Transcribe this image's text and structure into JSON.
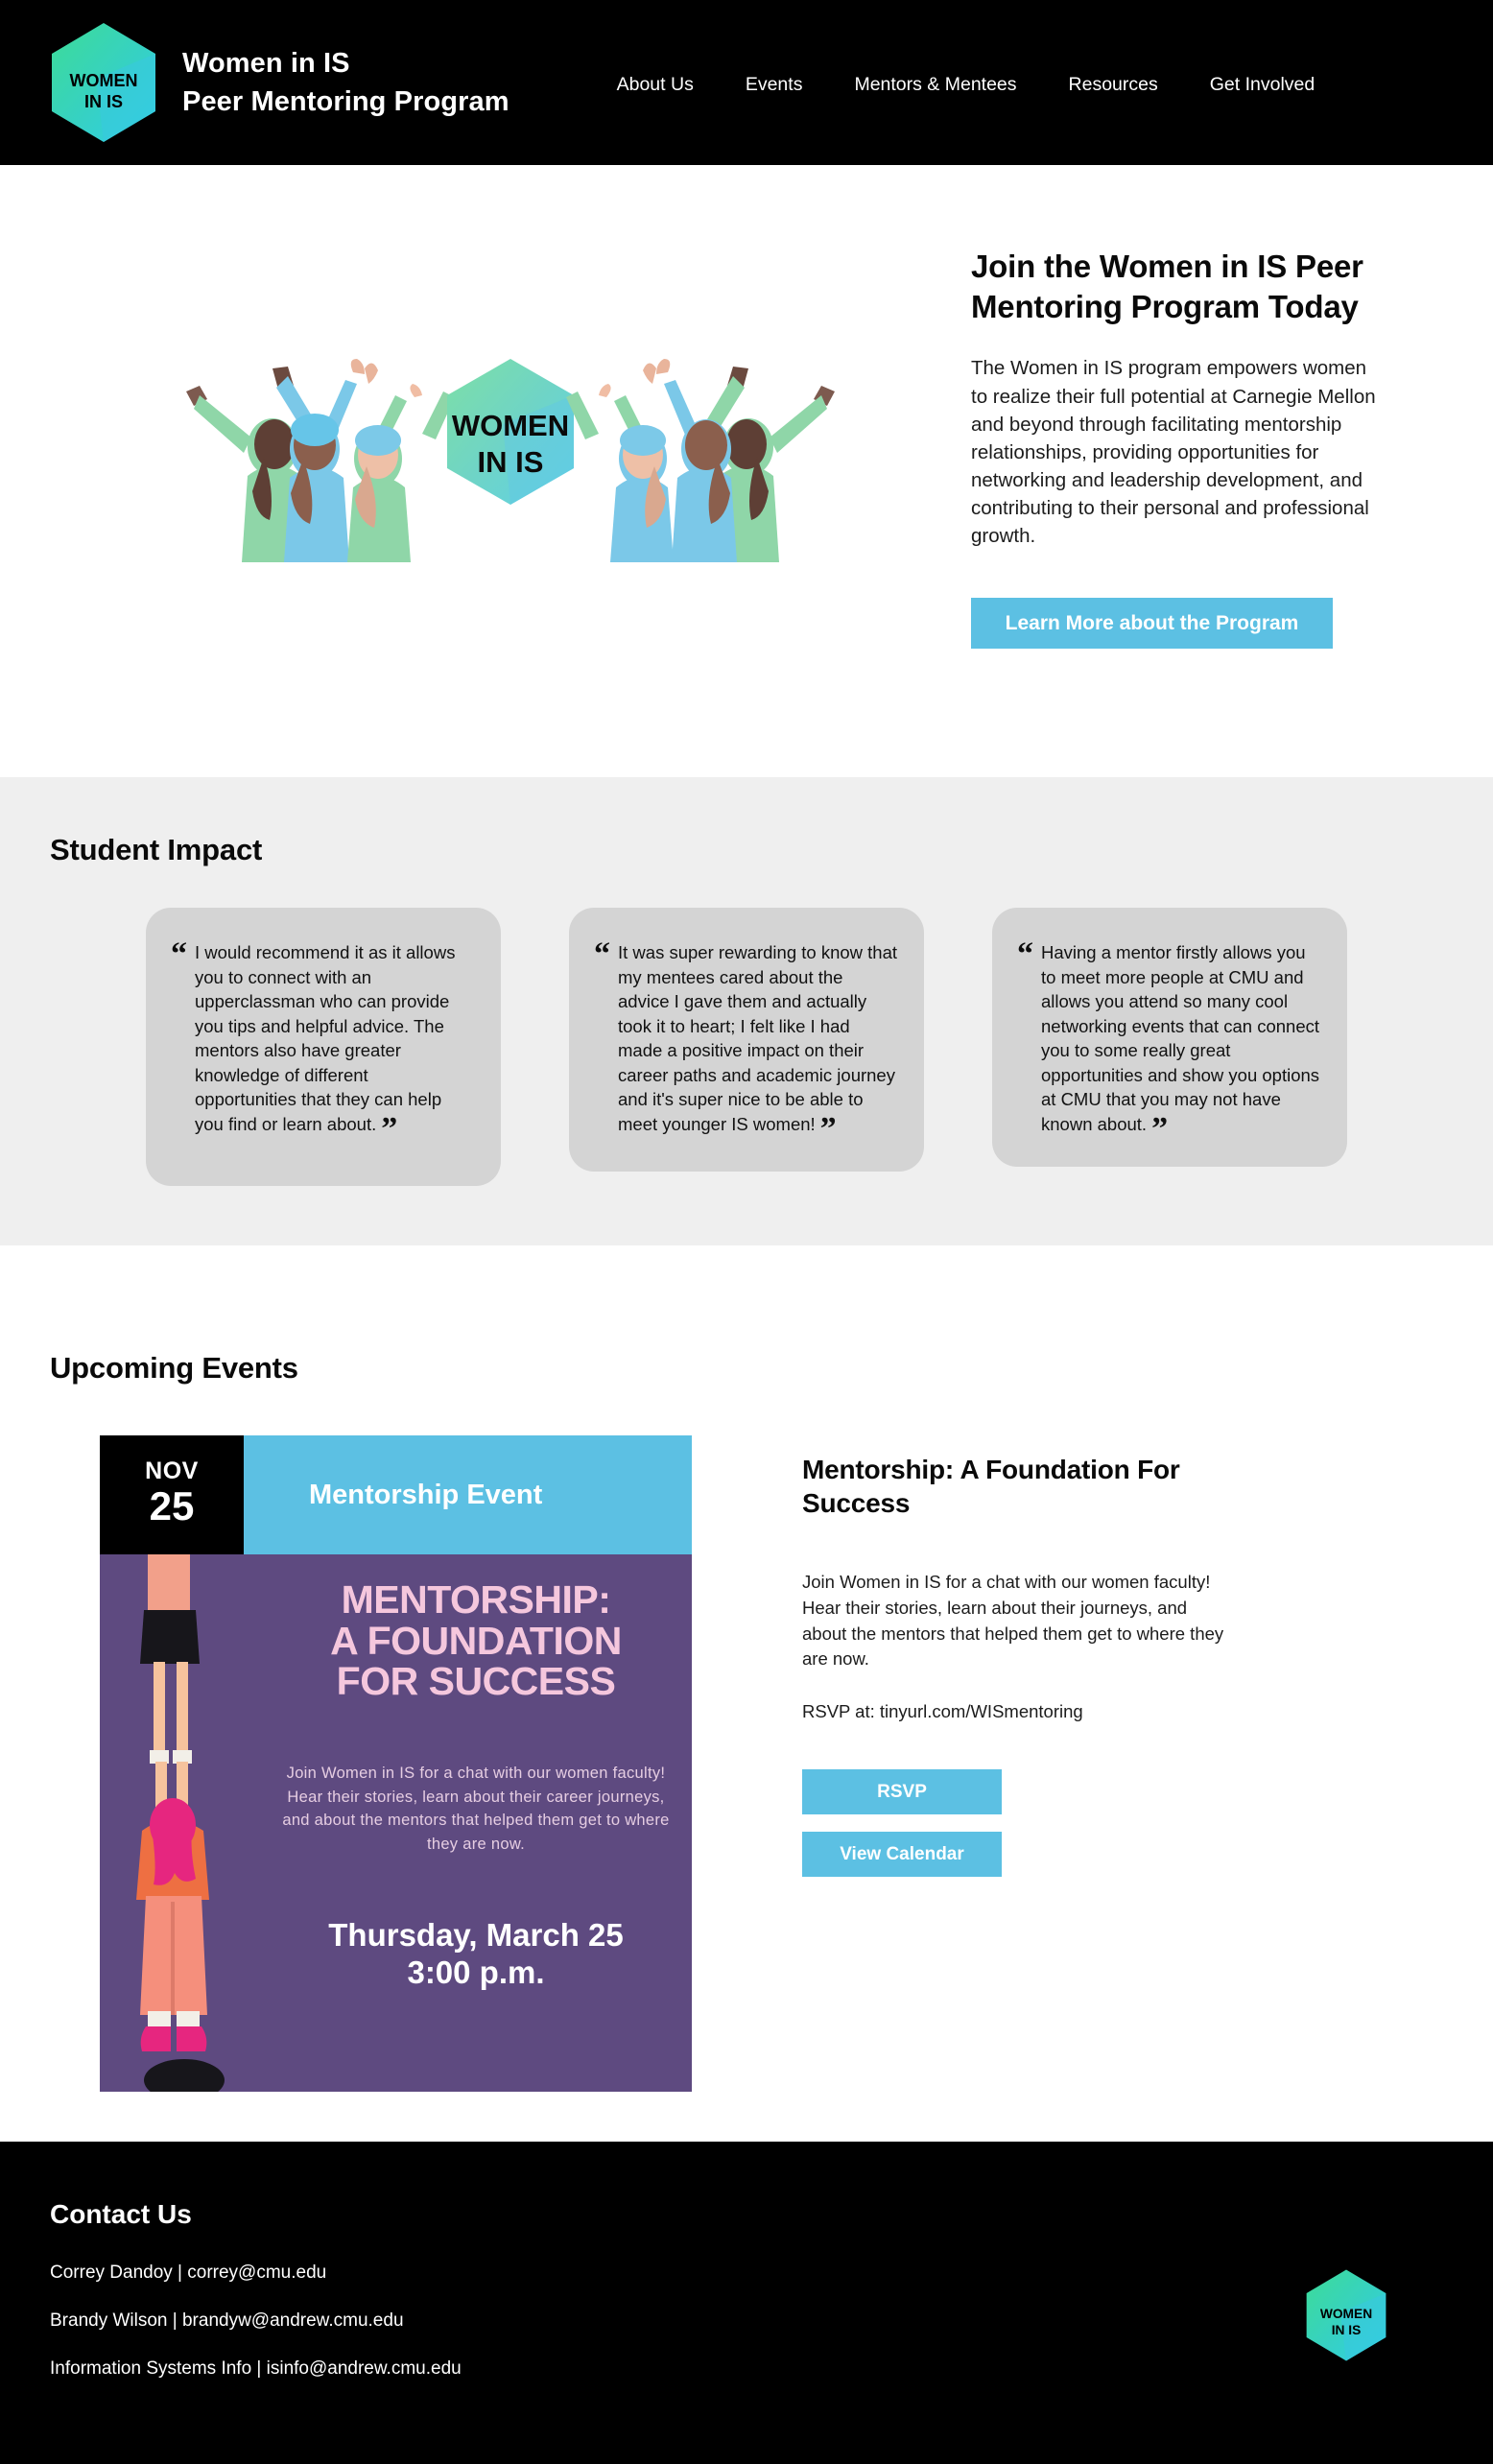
{
  "header": {
    "logo_alt": "Women in IS hexagon logo",
    "logo_text_line1": "WOMEN",
    "logo_text_line2": "IN IS",
    "brand_title": "Women in IS\nPeer Mentoring Program",
    "nav": [
      {
        "label": "About Us"
      },
      {
        "label": "Events"
      },
      {
        "label": "Mentors & Mentees"
      },
      {
        "label": "Resources"
      },
      {
        "label": "Get Involved"
      }
    ]
  },
  "hero": {
    "illustration_label": "Women in IS group illustration",
    "illustration_text_line1": "WOMEN",
    "illustration_text_line2": "IN IS",
    "title": "Join the Women in IS Peer Mentoring Program Today",
    "body": "The Women in IS program empowers women to realize their full potential at Carnegie Mellon and beyond through facilitating mentorship relationships, providing opportunities for networking and leadership development, and contributing to their personal and professional growth.",
    "cta_label": "Learn More about the Program"
  },
  "impact": {
    "title": "Student Impact",
    "open_quote": "“",
    "close_quote": "”",
    "quotes": [
      {
        "text": "I would recommend it as it allows you to connect with an upperclassman who can provide you tips and helpful advice. The mentors also have greater knowledge of different opportunities that they can help you find or learn about."
      },
      {
        "text": "It was super rewarding to know that my mentees cared about the advice I gave them and actually took it to heart; I felt like I had made a positive impact on their career paths and academic journey and it's super nice to be able to meet younger IS women!"
      },
      {
        "text": "Having a mentor firstly allows you to meet more people at CMU and allows you attend so many cool networking events that can connect you to some really great opportunities and show you options at CMU that you may not have known about."
      }
    ]
  },
  "events": {
    "title": "Upcoming Events",
    "card": {
      "month": "NOV",
      "day": "25",
      "banner_label": "Mentorship Event",
      "poster": {
        "title": "MENTORSHIP:\nA FOUNDATION\nFOR SUCCESS",
        "body": "Join Women in IS for a chat with our women faculty! Hear their stories, learn about their career journeys, and about the mentors that helped them get to where they are now.",
        "when": "Thursday, March 25\n3:00 p.m."
      }
    },
    "detail": {
      "title": "Mentorship: A Foundation For Success",
      "body": "Join Women in IS for a chat with our women faculty! Hear their stories, learn about their journeys, and about the mentors that helped them get to where they are now.",
      "rsvp_line": "RSVP at: tinyurl.com/WISmentoring",
      "rsvp_label": "RSVP",
      "calendar_label": "View Calendar"
    }
  },
  "footer": {
    "title": "Contact Us",
    "contacts": [
      {
        "line": "Correy Dandoy | correy@cmu.edu"
      },
      {
        "line": "Brandy Wilson | brandyw@andrew.cmu.edu"
      },
      {
        "line": "Information Systems Info | isinfo@andrew.cmu.edu"
      }
    ],
    "logo_text_line1": "WOMEN",
    "logo_text_line2": "IN IS"
  },
  "colors": {
    "accent_blue": "#5cc0e3",
    "black": "#000000",
    "gray_section": "#efefef",
    "quote_card": "#d4d4d4",
    "poster_purple": "#5e4a80",
    "poster_pink": "#f5c7dd",
    "logo_green": "#3ddc97",
    "logo_cyan": "#3ec8e8"
  }
}
